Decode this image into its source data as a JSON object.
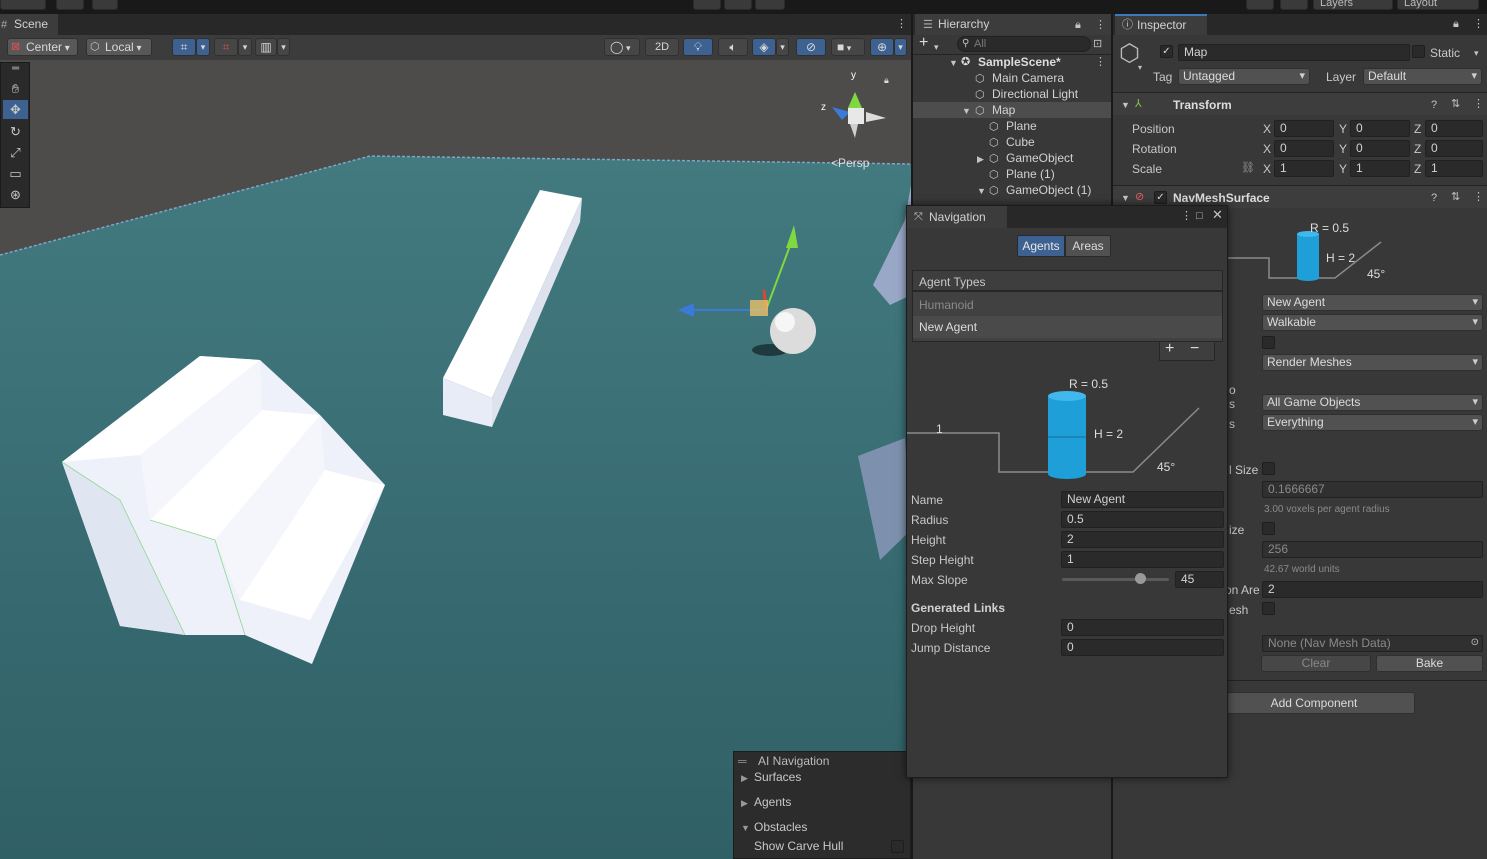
{
  "topbar": {
    "layers": "Layers",
    "layout": "Layout"
  },
  "scene": {
    "tab": "Scene",
    "center": "Center",
    "local": "Local",
    "btn2d": "2D",
    "persp": "Persp",
    "gizmo_y": "y",
    "gizmo_z": "z"
  },
  "ainav": {
    "title": "AI Navigation",
    "items": [
      "Surfaces",
      "Agents",
      "Obstacles"
    ],
    "show_carve": "Show Carve Hull"
  },
  "hierarchy": {
    "tab": "Hierarchy",
    "search_placeholder": "All",
    "scene": "SampleScene*",
    "items": [
      "Main Camera",
      "Directional Light",
      "Map",
      "Plane",
      "Cube",
      "GameObject",
      "Plane (1)",
      "GameObject (1)"
    ]
  },
  "inspector": {
    "tab": "Inspector",
    "name": "Map",
    "static": "Static",
    "tag_label": "Tag",
    "tag": "Untagged",
    "layer_label": "Layer",
    "layer": "Default",
    "transform": {
      "title": "Transform",
      "rows": [
        {
          "label": "Position",
          "x": "0",
          "y": "0",
          "z": "0"
        },
        {
          "label": "Rotation",
          "x": "0",
          "y": "0",
          "z": "0"
        },
        {
          "label": "Scale",
          "x": "1",
          "y": "1",
          "z": "1"
        }
      ],
      "axis_x": "X",
      "axis_y": "Y",
      "axis_z": "Z"
    },
    "navsurface": {
      "title": "NavMeshSurface",
      "r": "R = 0.5",
      "h": "H = 2",
      "angle": "45°",
      "agent": "New Agent",
      "area": "Walkable",
      "use_geometry": "Render Meshes",
      "collect": "All Game Objects",
      "include_layers": "Everything",
      "voxel_label_cut": "l Size",
      "voxel_value": "0.1666667",
      "voxel_hint": "3.00 voxels per agent radius",
      "tile_label_cut": "ize",
      "tile_value": "256",
      "tile_hint": "42.67 world units",
      "min_region_cut": "on Are",
      "min_region": "2",
      "build_height_cut": "esh",
      "label_s1": "s",
      "label_s2": "s",
      "label_o": "o",
      "navdata": "None (Nav Mesh Data)",
      "clear": "Clear",
      "bake": "Bake"
    },
    "add_component": "Add Component"
  },
  "navigation": {
    "title": "Navigation",
    "tabs": [
      "Agents",
      "Areas"
    ],
    "agent_types": "Agent Types",
    "types": [
      "Humanoid",
      "New Agent"
    ],
    "plus": "+",
    "minus": "−",
    "diagram": {
      "r": "R = 0.5",
      "h": "H = 2",
      "step": "1",
      "angle": "45°"
    },
    "fields": [
      {
        "label": "Name",
        "value": "New Agent"
      },
      {
        "label": "Radius",
        "value": "0.5"
      },
      {
        "label": "Height",
        "value": "2"
      },
      {
        "label": "Step Height",
        "value": "1"
      }
    ],
    "max_slope_label": "Max Slope",
    "max_slope": "45",
    "max_slope_fraction": 0.73,
    "gen_links": "Generated Links",
    "drop_label": "Drop Height",
    "drop": "0",
    "jump_label": "Jump Distance",
    "jump": "0"
  }
}
